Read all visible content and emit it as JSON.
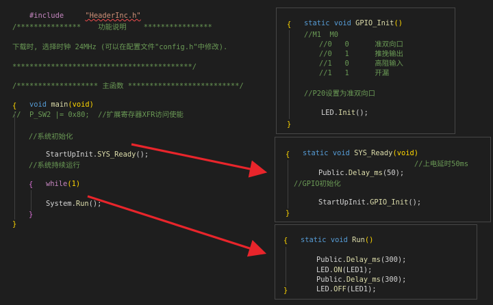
{
  "main": {
    "include_directive": "#include",
    "include_file": "\"HeaderInc.h\"",
    "comment1": "/***************    功能说明    ****************",
    "comment2": "下载时, 选择时钟 24MHz (可以在配置文件\"config.h\"中修改).",
    "comment3": "******************************************/",
    "comment4": "/******************* 主函数 **************************/",
    "main_ret": "void",
    "main_name": "main",
    "main_params": "(void)",
    "open_brace": "{",
    "line_psw2": "//  P_SW2 |= 0x80;  //扩展寄存器XFR访问使能",
    "comment_init": "//系统初始化",
    "call_init_obj": "StartUpInit.",
    "call_init_fn": "SYS_Ready",
    "call_init_end": "();",
    "comment_run": "//系统持续运行",
    "while_kw": "while",
    "while_cond": "(1)",
    "inner_open": "{",
    "call_run_obj": "System.",
    "call_run_fn": "Run",
    "call_run_end": "();",
    "inner_close": "}",
    "close_brace": "}"
  },
  "panel_gpio": {
    "sig_static": "static",
    "sig_void": "void",
    "sig_name": "GPIO_Init",
    "sig_params": "()",
    "open": "{",
    "c_head": "//M1  M0",
    "c_rows": [
      "//0   0      准双向口",
      "//0   1      推挽输出",
      "//1   0      高阻输入",
      "//1   1      开漏"
    ],
    "c_p20": "//P20设置为准双向口",
    "call_obj": "LED.",
    "call_fn": "Init",
    "call_end": "();",
    "close": "}"
  },
  "panel_sys": {
    "sig_static": "static",
    "sig_void": "void",
    "sig_name": "SYS_Ready",
    "sig_params": "(void)",
    "open": "{",
    "delay_obj": "Public.",
    "delay_fn": "Delay_ms",
    "delay_arg": "(50);",
    "delay_cmt": "//上电延时50ms",
    "c_gpio": "//GPIO初始化",
    "gpio_obj": "StartUpInit.",
    "gpio_fn": "GPIO_Init",
    "gpio_end": "();",
    "close": "}"
  },
  "panel_run": {
    "sig_static": "static",
    "sig_void": "void",
    "sig_name": "Run",
    "sig_params": "()",
    "open": "{",
    "l1_obj": "Public.",
    "l1_fn": "Delay_ms",
    "l1_arg": "(300);",
    "l2_obj": "LED.",
    "l2_fn": "ON",
    "l2_arg": "(LED1);",
    "l3_obj": "Public.",
    "l3_fn": "Delay_ms",
    "l3_arg": "(300);",
    "l4_obj": "LED.",
    "l4_fn": "OFF",
    "l4_arg": "(LED1);",
    "close": "}"
  },
  "colors": {
    "background": "#1e1e1e",
    "keyword": "#569cd6",
    "function": "#dcdcaa",
    "comment": "#6a9955",
    "string": "#ce9178",
    "preprocessor": "#c586c0",
    "bracket": "#ffd700",
    "arrow": "#e8252b"
  }
}
